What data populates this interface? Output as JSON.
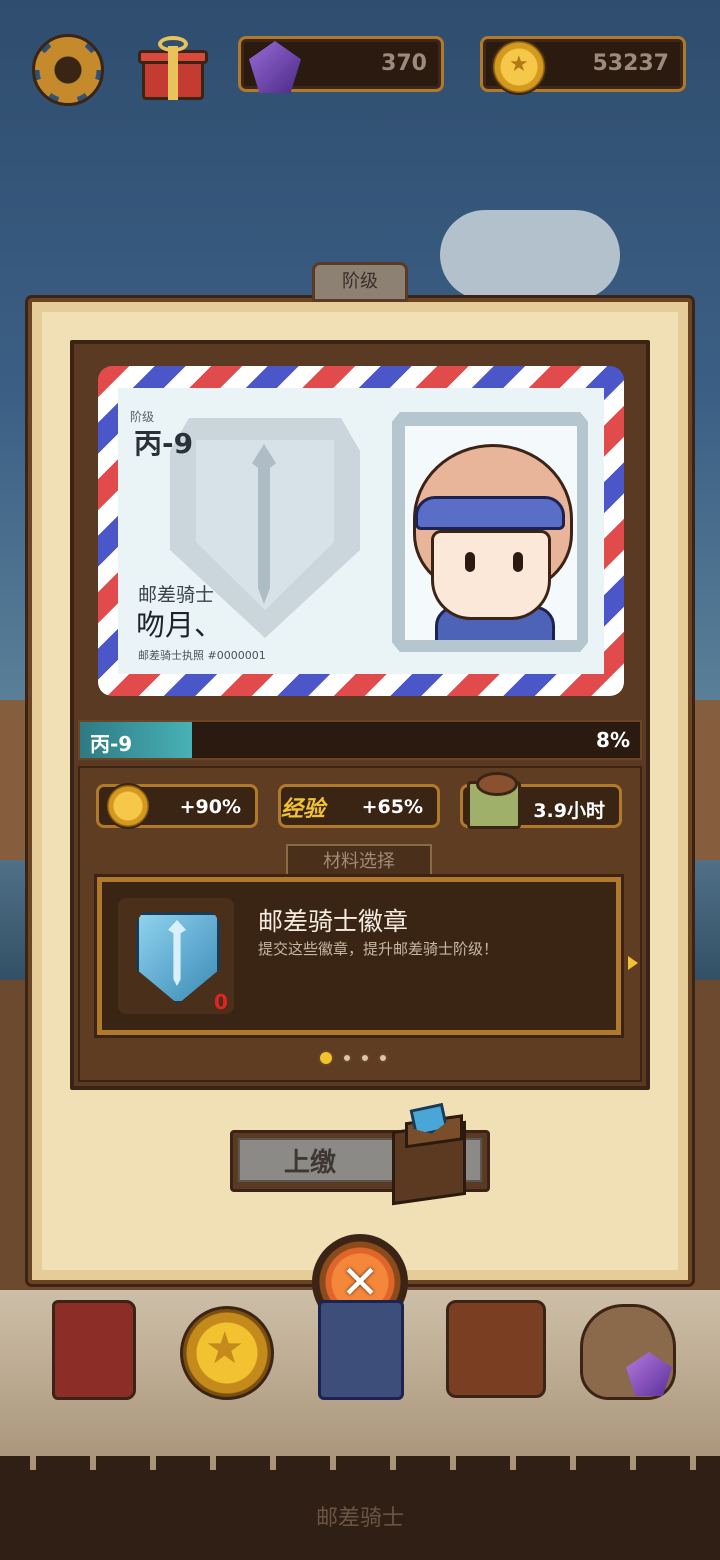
{
  "hud": {
    "gems": "370",
    "coins": "53237",
    "settings_icon": "gear-icon",
    "gift_icon": "gift-icon"
  },
  "panel": {
    "title": "阶级",
    "license": {
      "rank_caption": "阶级",
      "rank_value": "丙-9",
      "role": "邮差骑士",
      "player_name": "吻月、",
      "license_number": "邮差骑士执照 #0000001"
    },
    "progress": {
      "label": "丙-9",
      "percent_text": "8%",
      "fraction": 0.2
    },
    "bonuses": [
      {
        "icon": "coin-icon",
        "value": "+90%"
      },
      {
        "label": "经验",
        "value": "+65%"
      },
      {
        "icon": "crate-icon",
        "value": "3.9小时"
      }
    ],
    "materials": {
      "tab_label": "材料选择",
      "item_title": "邮差骑士徽章",
      "item_desc": "提交这些徽章，提升邮差骑士阶级！",
      "item_count": "0",
      "page_count": 4,
      "active_page": 1
    },
    "submit_label": "上缴"
  },
  "bottom": {
    "label": "邮差骑士"
  },
  "colors": {
    "panel_bg": "#f1dfb6",
    "frame_brown": "#5a3a22",
    "accent_gold": "#f2c230",
    "progress_teal": "#48b2b6",
    "count_red": "#e02424"
  }
}
